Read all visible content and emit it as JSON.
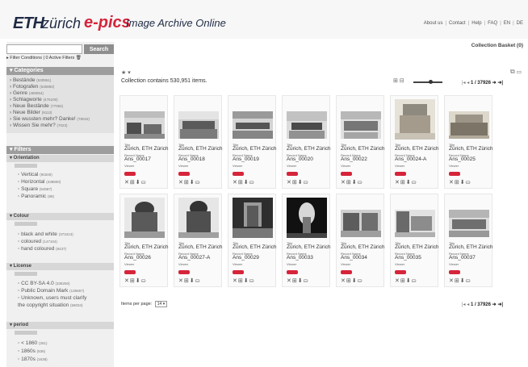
{
  "header": {
    "logo_eth": "ETH",
    "logo_zurich": "zürich",
    "logo_epics": "e-pics",
    "title": "Image Archive Online",
    "nav": [
      "About us",
      "Contact",
      "Help",
      "FAQ",
      "EN",
      "DE"
    ]
  },
  "search": {
    "value": "",
    "placeholder": "",
    "button": "Search"
  },
  "filter_conditions": "▸ Filter Conditions | 0 Active Filters 🗑",
  "categories": {
    "title": "▾ Categories",
    "items": [
      {
        "label": "› Bestände",
        "count": "(530951)"
      },
      {
        "label": "› Fotografen",
        "count": "(530892)"
      },
      {
        "label": "› Genre",
        "count": "(469054)"
      },
      {
        "label": "› Schlagworte",
        "count": "(476100)"
      },
      {
        "label": "› Neue Bestände",
        "count": "(77084)"
      },
      {
        "label": "› Neue Bilder",
        "count": "(8113)"
      },
      {
        "label": "› Sie wussten mehr? Danke!",
        "count": "(78042)"
      },
      {
        "label": "› Wissen Sie mehr?",
        "count": "(7023)"
      }
    ]
  },
  "filters": {
    "title": "▾ Filters",
    "groups": [
      {
        "title": "▾ Orientation",
        "items": [
          {
            "label": "◦ Vertical",
            "count": "(90200)"
          },
          {
            "label": "◦ Horizontal",
            "count": "(338800)"
          },
          {
            "label": "◦ Square",
            "count": "(54587)"
          },
          {
            "label": "◦ Panoramic",
            "count": "(89)"
          }
        ]
      },
      {
        "title": "▾ Colour",
        "items": [
          {
            "label": "◦ black and white",
            "count": "(373413)"
          },
          {
            "label": "◦ coloured",
            "count": "(147104)"
          },
          {
            "label": "◦ hand coloured",
            "count": "(8437)"
          }
        ]
      },
      {
        "title": "▾ License",
        "items": [
          {
            "label": "◦ CC BY-SA 4.0",
            "count": "(338250)"
          },
          {
            "label": "◦ Public Domain Mark",
            "count": "(136667)"
          },
          {
            "label": "◦ Unknown, users must clarify",
            "count": ""
          },
          {
            "label": "   the copyright situation",
            "count": "(56034)"
          }
        ]
      },
      {
        "title": "▾ period",
        "items": [
          {
            "label": "◦ < 1860",
            "count": "(261)"
          },
          {
            "label": "◦ 1860s",
            "count": "(836)"
          },
          {
            "label": "◦ 1870s",
            "count": "(1638)"
          }
        ]
      }
    ]
  },
  "main": {
    "basket": "Collection Basket (0)",
    "count_text": "Collection contains 530,951 items.",
    "page_indicator": "1 / 37926",
    "per_page_label": "Items per page:",
    "per_page_value": "14 ▾",
    "zoom_level": 0.6
  },
  "cards": [
    {
      "title_label": "Title",
      "title": "Zürich, ETH Zürich",
      "record_label": "Record Name",
      "record": "Ans_00017",
      "viewer_label": "Viewer"
    },
    {
      "title_label": "Title",
      "title": "Zürich, ETH Zürich",
      "record_label": "Record Name",
      "record": "Ans_00018",
      "viewer_label": "Viewer"
    },
    {
      "title_label": "Title",
      "title": "Zürich, ETH Zürich",
      "record_label": "Record Name",
      "record": "Ans_00019",
      "viewer_label": "Viewer"
    },
    {
      "title_label": "Title",
      "title": "Zürich, ETH Zürich",
      "record_label": "Record Name",
      "record": "Ans_00020",
      "viewer_label": "Viewer"
    },
    {
      "title_label": "Title",
      "title": "Zürich, ETH Zürich",
      "record_label": "Record Name",
      "record": "Ans_00022",
      "viewer_label": "Viewer"
    },
    {
      "title_label": "Title",
      "title": "Zürich, ETH Zürich",
      "record_label": "Record Name",
      "record": "Ans_00024-A",
      "viewer_label": "Viewer"
    },
    {
      "title_label": "Title",
      "title": "Zürich, ETH Zürich",
      "record_label": "Record Name",
      "record": "Ans_00025",
      "viewer_label": "Viewer"
    },
    {
      "title_label": "Title",
      "title": "Zürich, ETH Zürich",
      "record_label": "Record Name",
      "record": "Ans_00026",
      "viewer_label": "Viewer"
    },
    {
      "title_label": "Title",
      "title": "Zürich, ETH Zürich",
      "record_label": "Record Name",
      "record": "Ans_00027-A",
      "viewer_label": "Viewer"
    },
    {
      "title_label": "Title",
      "title": "Zürich, ETH Zürich",
      "record_label": "Record Name",
      "record": "Ans_00029",
      "viewer_label": "Viewer"
    },
    {
      "title_label": "Title",
      "title": "Zürich, ETH Zürich",
      "record_label": "Record Name",
      "record": "Ans_00033",
      "viewer_label": "Viewer"
    },
    {
      "title_label": "Title",
      "title": "Zürich, ETH Zürich",
      "record_label": "Record Name",
      "record": "Ans_00034",
      "viewer_label": "Viewer"
    },
    {
      "title_label": "Title",
      "title": "Zürich, ETH Zürich",
      "record_label": "Record Name",
      "record": "Ans_00035",
      "viewer_label": "Viewer"
    },
    {
      "title_label": "Title",
      "title": "Zürich, ETH Zürich",
      "record_label": "Record Name",
      "record": "Ans_00037",
      "viewer_label": "Viewer"
    }
  ],
  "colors": {
    "brand_red": "#d6243a",
    "header_gray": "#9d9d9d",
    "sidebar_bg": "#f0f0f0"
  }
}
